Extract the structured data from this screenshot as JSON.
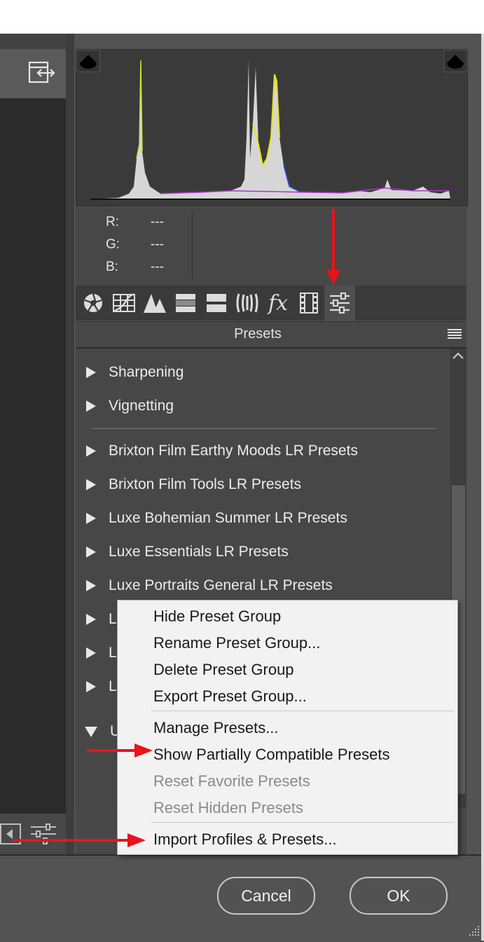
{
  "histogram_readout": {
    "r_label": "R:",
    "r_value": "---",
    "g_label": "G:",
    "g_value": "---",
    "b_label": "B:",
    "b_value": "---"
  },
  "toolbar": {
    "tools": [
      {
        "icon": "aperture-icon"
      },
      {
        "icon": "grid-icon"
      },
      {
        "icon": "mountains-icon"
      },
      {
        "icon": "split-toning-icon"
      },
      {
        "icon": "detail-icon"
      },
      {
        "icon": "lens-icon"
      },
      {
        "icon": "fx-icon",
        "label": "fx"
      },
      {
        "icon": "film-icon"
      },
      {
        "icon": "presets-sliders-icon"
      }
    ]
  },
  "presets_panel": {
    "title": "Presets",
    "items": [
      {
        "label": "Sharpening",
        "expanded": false
      },
      {
        "label": "Vignetting",
        "expanded": false
      },
      {
        "label": "Brixton Film Earthy Moods LR Presets",
        "expanded": false
      },
      {
        "label": "Brixton Film Tools LR Presets",
        "expanded": false
      },
      {
        "label": "Luxe Bohemian Summer LR Presets",
        "expanded": false
      },
      {
        "label": "Luxe Essentials LR Presets",
        "expanded": false
      },
      {
        "label": "Luxe Portraits General LR Presets",
        "expanded": false
      },
      {
        "label": "L",
        "expanded": false
      },
      {
        "label": "L",
        "expanded": false
      },
      {
        "label": "L",
        "expanded": false
      },
      {
        "label": "U",
        "expanded": true
      }
    ]
  },
  "context_menu": {
    "items": [
      {
        "label": "Hide Preset Group",
        "enabled": true
      },
      {
        "label": "Rename Preset Group...",
        "enabled": true
      },
      {
        "label": "Delete Preset Group",
        "enabled": true
      },
      {
        "label": "Export Preset Group...",
        "enabled": true
      },
      {
        "label": "Manage Presets...",
        "enabled": true
      },
      {
        "label": "Show Partially Compatible Presets",
        "enabled": true
      },
      {
        "label": "Reset Favorite Presets",
        "enabled": false
      },
      {
        "label": "Reset Hidden Presets",
        "enabled": false
      },
      {
        "label": "Import Profiles & Presets...",
        "enabled": true
      }
    ]
  },
  "buttons": {
    "cancel": "Cancel",
    "ok": "OK"
  },
  "colors": {
    "annotation_arrow": "#e8141b",
    "panel_bg": "#474747",
    "menu_bg": "#f2f2f2"
  }
}
